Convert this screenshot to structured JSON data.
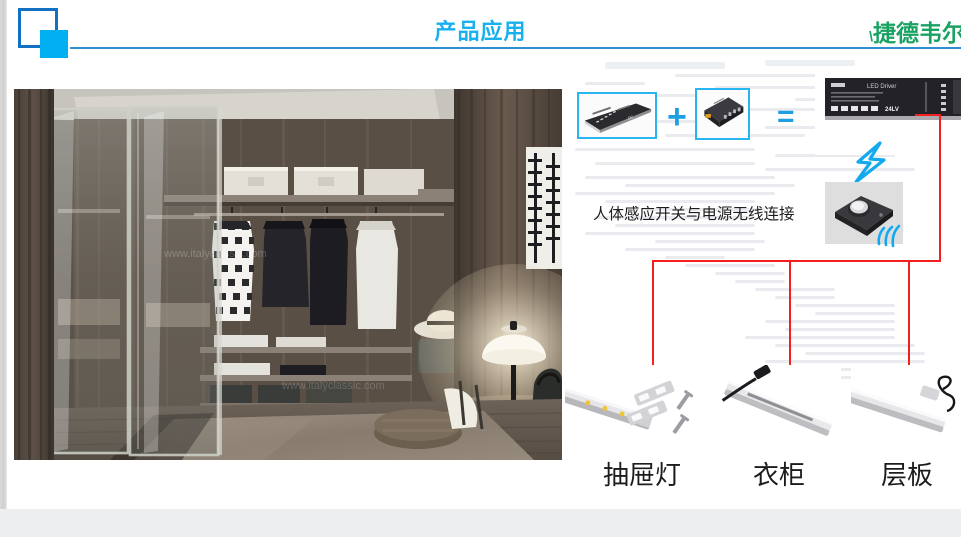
{
  "header": {
    "title": "产品应用",
    "brand": "捷德韦尔",
    "brand_tick": "\\",
    "logo_name": "square-logo"
  },
  "diagram": {
    "operator_plus": "+",
    "operator_equals": "=",
    "caption": "人体感应开关与电源无线连接",
    "devices": [
      {
        "name": "led-driver-power-supply"
      },
      {
        "name": "wireless-controller-box"
      },
      {
        "name": "combined-led-driver-module"
      },
      {
        "name": "pir-motion-sensor-switch"
      }
    ],
    "icons": {
      "lightning": "lightning-bolt-icon",
      "wireless": "wireless-waves-icon"
    },
    "connector_color": "#f41f1f"
  },
  "products": [
    {
      "label": "抽屉灯",
      "image": "drawer-led-bar-with-clips-and-screws"
    },
    {
      "label": "衣柜",
      "image": "wardrobe-led-bar-with-cable"
    },
    {
      "label": "层板",
      "image": "shelf-led-bar-with-power-cord"
    }
  ],
  "photo": {
    "alt": "walk-in-wardrobe-interior-with-lamp"
  },
  "colors": {
    "title_blue": "#19b0ef",
    "brand_green": "#1aa263",
    "accent_cyan": "#27b6ef",
    "rule_blue": "#2f8fd0",
    "connector_red": "#f41f1f"
  }
}
